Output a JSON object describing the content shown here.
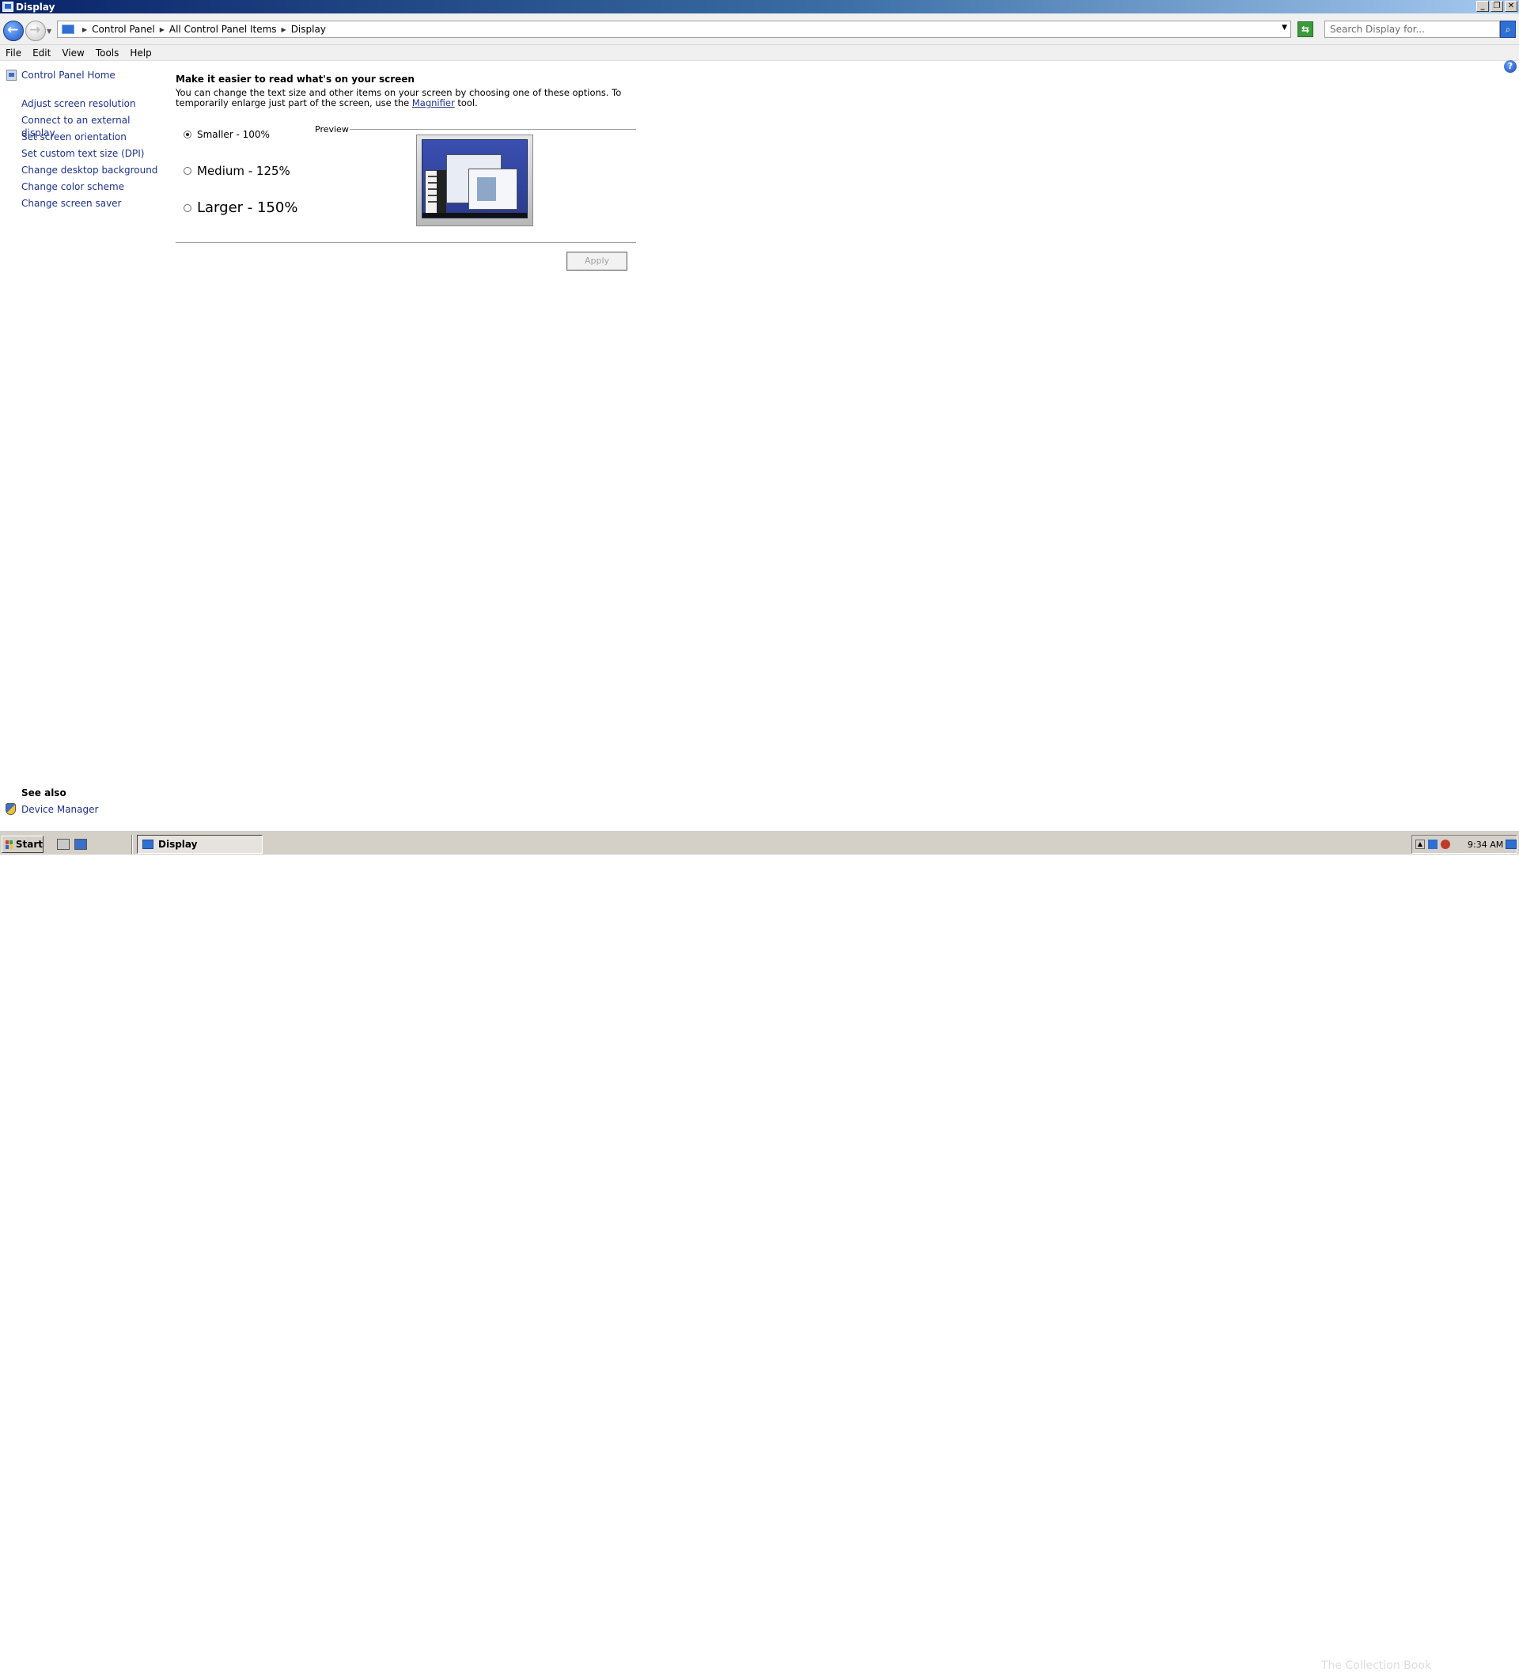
{
  "window": {
    "title": "Display"
  },
  "address_bar": {
    "crumbs": [
      "Control Panel",
      "All Control Panel Items",
      "Display"
    ],
    "search_placeholder": "Search Display for..."
  },
  "menu": [
    "File",
    "Edit",
    "View",
    "Tools",
    "Help"
  ],
  "sidebar": {
    "home_label": "Control Panel Home",
    "tasks": [
      "Adjust screen resolution",
      "Connect to an external display",
      "Set screen orientation",
      "Set custom text size (DPI)",
      "Change desktop background",
      "Change color scheme",
      "Change screen saver"
    ],
    "see_also_title": "See also",
    "see_also_items": [
      "Device Manager"
    ]
  },
  "main": {
    "heading": "Make it easier to read what's on your screen",
    "description_before": "You can change the text size and other items on your screen by choosing one of these options. To temporarily enlarge just part of the screen, use the ",
    "magnifier_link": "Magnifier",
    "description_after": " tool.",
    "options": [
      {
        "label": "Smaller - 100%",
        "selected": true
      },
      {
        "label": "Medium - 125%",
        "selected": false
      },
      {
        "label": "Larger - 150%",
        "selected": false
      }
    ],
    "preview_label": "Preview",
    "apply_label": "Apply",
    "apply_enabled": false
  },
  "taskbar": {
    "start_label": "Start",
    "active_task": "Display",
    "clock": "9:34 AM",
    "watermark": "The Collection Book"
  },
  "icons": {
    "back": "back-arrow-icon",
    "forward": "forward-arrow-icon",
    "refresh": "refresh-icon",
    "search": "search-icon",
    "help": "help-icon",
    "home": "control-panel-icon",
    "device_manager": "shield-icon"
  }
}
